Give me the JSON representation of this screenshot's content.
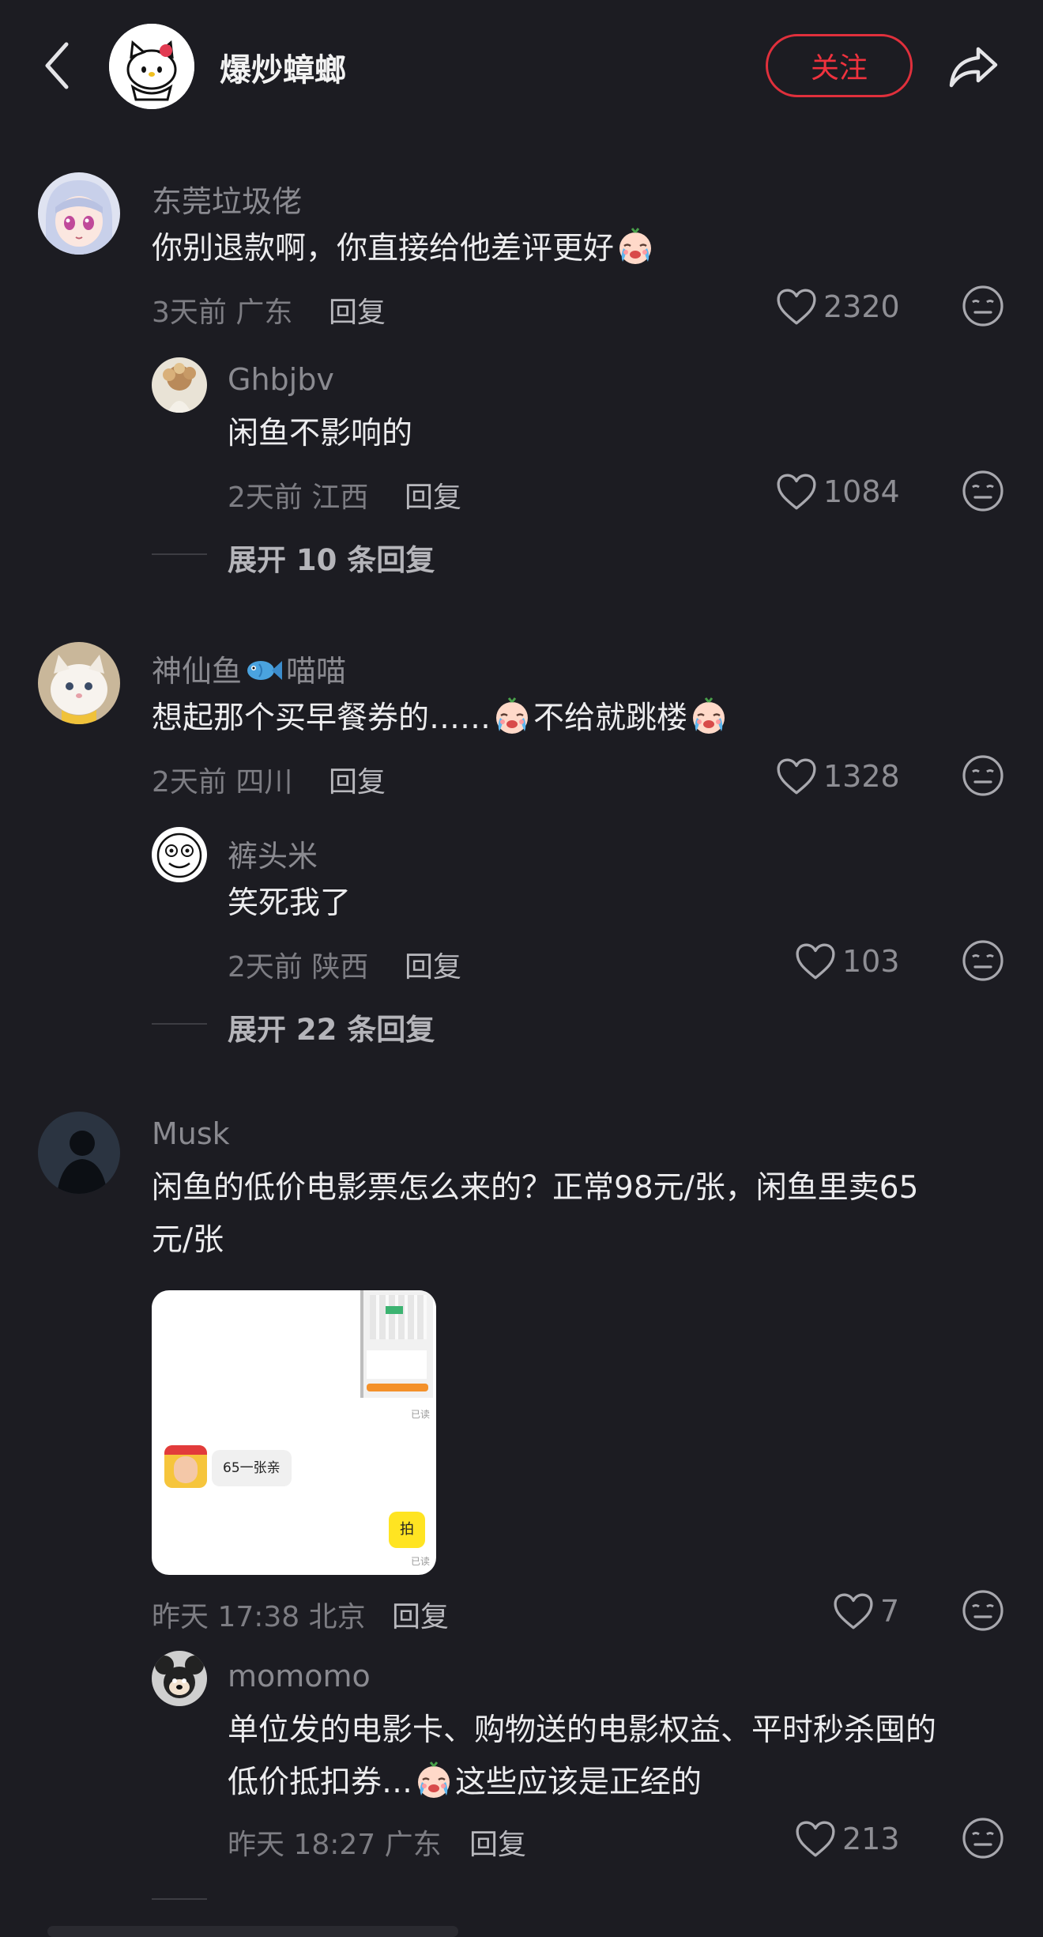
{
  "header": {
    "title": "爆炒蟑螂",
    "follow_label": "关注"
  },
  "comments": [
    {
      "username": "东莞垃圾佬",
      "text_main": "你别退款啊，你直接给他差评更好",
      "time": "3天前",
      "location": "广东",
      "reply_label": "回复",
      "likes": "2320",
      "replies": [
        {
          "username": "Ghbjbv",
          "text": "闲鱼不影响的",
          "time": "2天前",
          "location": "江西",
          "reply_label": "回复",
          "likes": "1084"
        }
      ],
      "expand_label": "展开 10 条回复"
    },
    {
      "username_a": "神仙鱼",
      "username_b": "喵喵",
      "text_a": "想起那个买早餐券的……",
      "text_b": "不给就跳楼",
      "time": "2天前",
      "location": "四川",
      "reply_label": "回复",
      "likes": "1328",
      "replies": [
        {
          "username": "裤头米",
          "text": "笑死我了",
          "time": "2天前",
          "location": "陕西",
          "reply_label": "回复",
          "likes": "103"
        }
      ],
      "expand_label": "展开 22 条回复"
    },
    {
      "username": "Musk",
      "text_line1": "闲鱼的低价电影票怎么来的？正常98元/张，闲鱼里卖65",
      "text_line2": "元/张",
      "image": {
        "bubble_text": "65一张亲",
        "reply_bubble": "拍",
        "read_label": "已读"
      },
      "time": "昨天 17:38",
      "location": "北京",
      "reply_label": "回复",
      "likes": "7",
      "replies": [
        {
          "username": "momomo",
          "text_line1": "单位发的电影卡、购物送的电影权益、平时秒杀囤的",
          "text_line2_a": "低价抵扣券…",
          "text_line2_b": "这些应该是正经的",
          "time": "昨天 18:27",
          "location": "广东",
          "reply_label": "回复",
          "likes": "213"
        }
      ]
    }
  ],
  "colors": {
    "background": "#1c1c22",
    "accent": "#f0323e"
  },
  "icons": [
    "back-icon",
    "share-icon",
    "heart-icon",
    "reaction-icon",
    "crying-emoji-icon",
    "fish-emoji-icon"
  ]
}
